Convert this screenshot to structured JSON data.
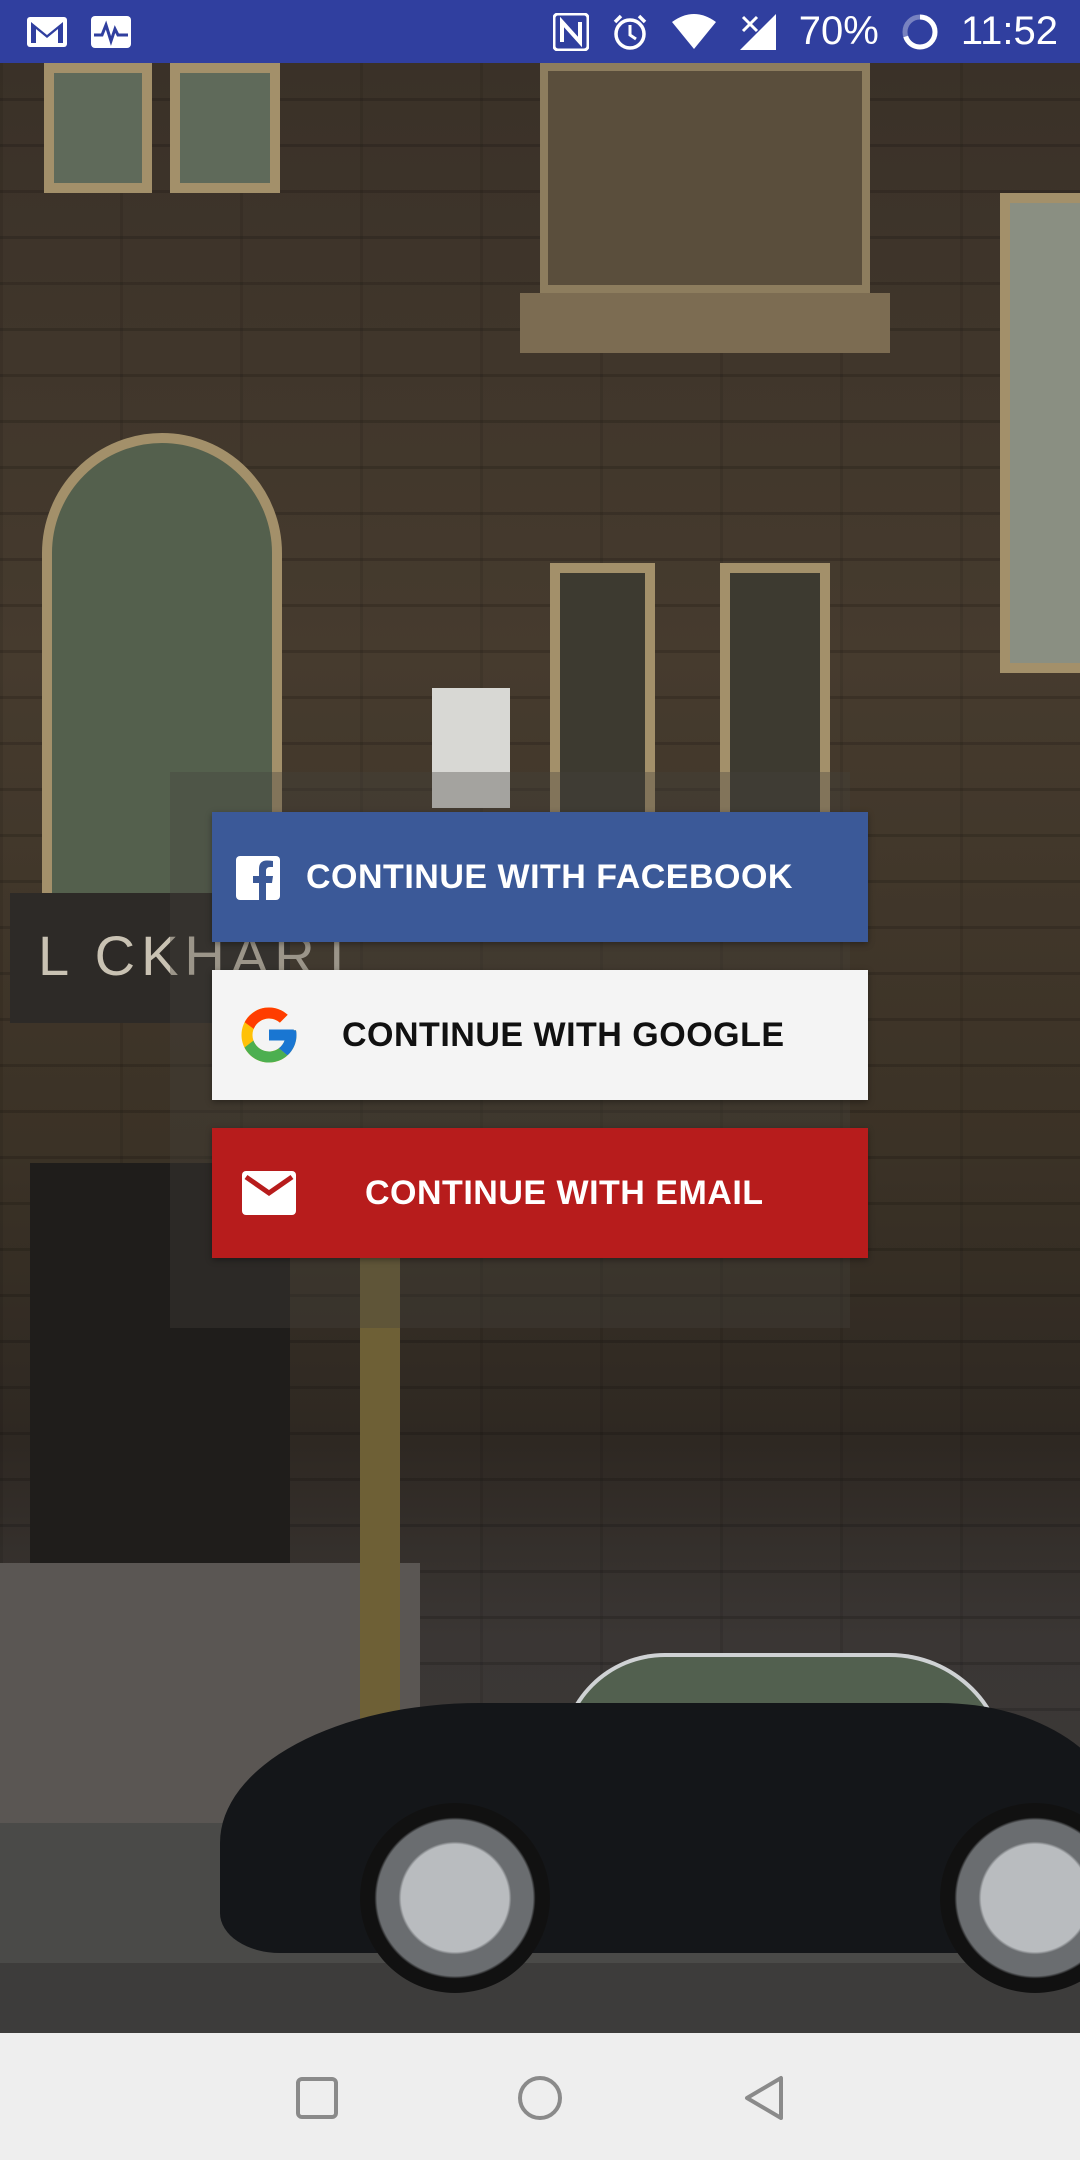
{
  "status_bar": {
    "left_icons": [
      "gmail-icon",
      "activity-monitor-icon"
    ],
    "right_icons": [
      "nfc-icon",
      "alarm-icon",
      "wifi-icon",
      "signal-icon",
      "battery-icon"
    ],
    "battery_percent": "70%",
    "time": "11:52"
  },
  "background": {
    "sign_text": "L CKHART"
  },
  "login": {
    "facebook": {
      "label": "CONTINUE WITH FACEBOOK",
      "icon": "facebook-icon",
      "color": "#3b5998"
    },
    "google": {
      "label": "CONTINUE WITH GOOGLE",
      "icon": "google-icon",
      "color": "#f4f4f4"
    },
    "email": {
      "label": "CONTINUE WITH EMAIL",
      "icon": "mail-icon",
      "color": "#b71c1c"
    }
  },
  "nav_bar": {
    "buttons": [
      "recents-square-icon",
      "home-circle-icon",
      "back-triangle-icon"
    ]
  },
  "colors": {
    "status_bar": "#303f9f",
    "nav_bar": "#eeeeee"
  }
}
